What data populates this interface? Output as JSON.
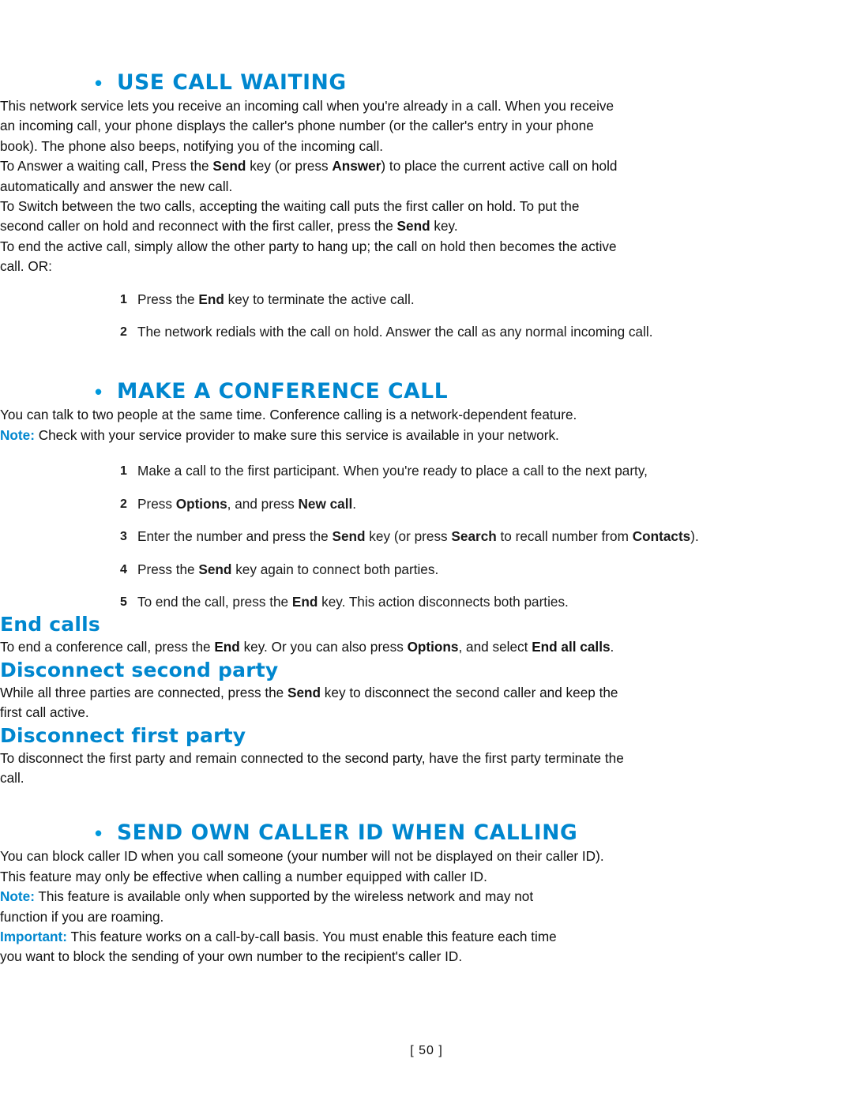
{
  "page": {
    "footer": "[ 50 ]"
  },
  "sections": {
    "call_waiting": {
      "title": "USE CALL WAITING",
      "p1_a": "This network service lets you receive an incoming call when you're already in a call. When you receive an incoming call, your phone displays the caller's phone number (or the caller's entry in your phone book). The phone also beeps, notifying you of the incoming call.",
      "p2_a": "To Answer a waiting call, Press the ",
      "p2_b": "Send",
      "p2_c": " key (or press ",
      "p2_d": "Answer",
      "p2_e": ") to place the current active call on hold automatically and answer the new call.",
      "p3_a": "To Switch between the two calls, accepting the waiting call puts the first caller on hold. To put the second caller on hold and reconnect with the first caller, press the ",
      "p3_b": "Send",
      "p3_c": " key.",
      "p4": "To end the active call, simply allow the other party to hang up; the call on hold then becomes the active call. OR:",
      "steps": [
        {
          "num": "1",
          "a": "Press the ",
          "b": "End",
          "c": " key to terminate the active call."
        },
        {
          "num": "2",
          "a": "The network redials with the call on hold. Answer the call as any normal incoming call.",
          "b": "",
          "c": ""
        }
      ]
    },
    "conference_call": {
      "title": "MAKE A CONFERENCE CALL",
      "p1": "You can talk to two people at the same time. Conference calling is a network-dependent feature.",
      "note_label": "Note:",
      "note_text": " Check with your service provider to make sure this service is available in your network.",
      "steps": [
        {
          "num": "1",
          "parts": [
            {
              "t": "Make a call to the first participant. When you're ready to place a call to the next party,",
              "b": false
            }
          ]
        },
        {
          "num": "2",
          "parts": [
            {
              "t": "Press ",
              "b": false
            },
            {
              "t": "Options",
              "b": true
            },
            {
              "t": ", and press ",
              "b": false
            },
            {
              "t": "New call",
              "b": true
            },
            {
              "t": ".",
              "b": false
            }
          ]
        },
        {
          "num": "3",
          "parts": [
            {
              "t": "Enter the number and press the ",
              "b": false
            },
            {
              "t": "Send",
              "b": true
            },
            {
              "t": " key (or press ",
              "b": false
            },
            {
              "t": "Search",
              "b": true
            },
            {
              "t": " to recall number from ",
              "b": false
            },
            {
              "t": "Contacts",
              "b": true
            },
            {
              "t": ").",
              "b": false
            }
          ]
        },
        {
          "num": "4",
          "parts": [
            {
              "t": "Press the ",
              "b": false
            },
            {
              "t": "Send",
              "b": true
            },
            {
              "t": " key again to connect both parties.",
              "b": false
            }
          ]
        },
        {
          "num": "5",
          "parts": [
            {
              "t": "To end the call, press the ",
              "b": false
            },
            {
              "t": "End",
              "b": true
            },
            {
              "t": " key. This action disconnects both parties.",
              "b": false
            }
          ]
        }
      ],
      "end_calls": {
        "title": "End calls",
        "p_parts": [
          {
            "t": "To end a conference call, press the ",
            "b": false
          },
          {
            "t": "End",
            "b": true
          },
          {
            "t": " key. Or you can also press ",
            "b": false
          },
          {
            "t": "Options",
            "b": true
          },
          {
            "t": ", and select ",
            "b": false
          },
          {
            "t": "End all calls",
            "b": true
          },
          {
            "t": ".",
            "b": false
          }
        ]
      },
      "disconnect_second": {
        "title": "Disconnect second party",
        "p_parts": [
          {
            "t": "While all three parties are connected, press the ",
            "b": false
          },
          {
            "t": "Send",
            "b": true
          },
          {
            "t": " key to disconnect the second caller and keep the first call active.",
            "b": false
          }
        ]
      },
      "disconnect_first": {
        "title": "Disconnect first party",
        "p_parts": [
          {
            "t": "To disconnect the first party and remain connected to the second party, have the first party terminate the call.",
            "b": false
          }
        ]
      }
    },
    "caller_id": {
      "title": "SEND OWN CALLER ID WHEN CALLING",
      "p1": "You can block caller ID when you call someone (your number will not be displayed on their caller ID). This feature may only be effective when calling a number equipped with caller ID.",
      "note_label": "Note:",
      "note_text": " This feature is available only when supported by the wireless network and may not function if you are roaming.",
      "important_label": "Important:",
      "important_text": " This feature works on a call-by-call basis. You must enable this feature each time you want to block the sending of your own number to the recipient's caller ID."
    }
  }
}
